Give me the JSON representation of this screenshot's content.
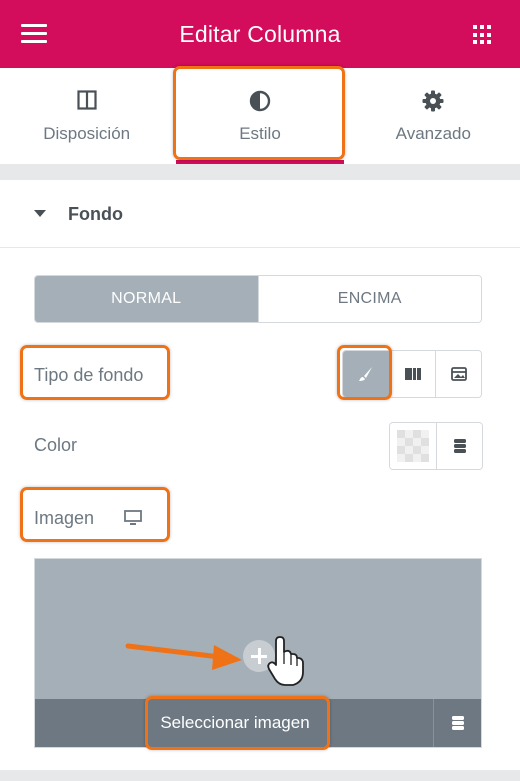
{
  "header": {
    "title": "Editar Columna",
    "menu_icon": "hamburger-icon",
    "apps_icon": "grid-icon",
    "color": "#d30c5c"
  },
  "tabs": [
    {
      "label": "Disposición",
      "icon": "columns-layout-icon",
      "active": false
    },
    {
      "label": "Estilo",
      "icon": "half-circle-contrast-icon",
      "active": true
    },
    {
      "label": "Avanzado",
      "icon": "gear-icon",
      "active": false
    }
  ],
  "section": {
    "title": "Fondo",
    "state_toggle": {
      "normal": "NORMAL",
      "hover": "ENCIMA",
      "selected": "NORMAL"
    },
    "background_type": {
      "label": "Tipo de fondo",
      "options": [
        "brush-icon",
        "gradient-icon",
        "video-icon"
      ],
      "selected": "brush-icon"
    },
    "color": {
      "label": "Color",
      "global_icon": "database-icon"
    },
    "image": {
      "label": "Imagen",
      "responsive_icon": "desktop-icon",
      "select_label": "Seleccionar imagen",
      "library_icon": "database-icon"
    }
  },
  "accent": {
    "highlight": "#f07216",
    "primary": "#d30c5c"
  }
}
